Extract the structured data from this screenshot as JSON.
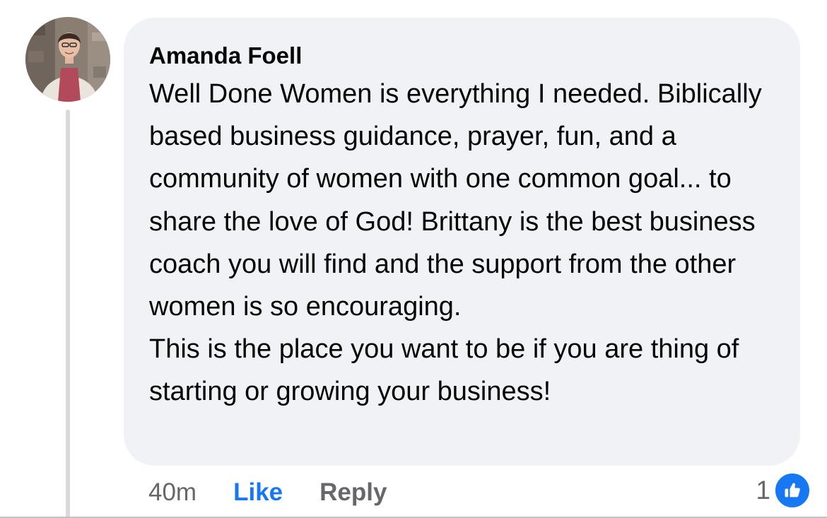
{
  "comment": {
    "author": "Amanda Foell",
    "paragraphs": [
      "Well Done Women is everything I needed. Biblically based business guidance, prayer, fun, and a community of women with one common goal... to share the love of God! Brittany is the best business coach you will find and the support from the other women is so encouraging.",
      "This is the place you want to be if you are thing of starting or growing your business!"
    ],
    "time": "40m",
    "like_label": "Like",
    "reply_label": "Reply",
    "reaction_count": "1",
    "reaction_icon": "thumbs-up-icon"
  },
  "colors": {
    "bubble_background": "#f0f2f5",
    "accent": "#1877f2",
    "muted_text": "#65676b"
  }
}
